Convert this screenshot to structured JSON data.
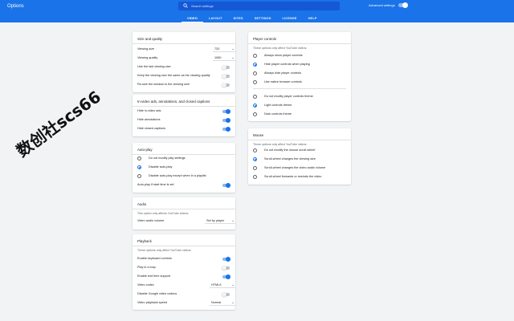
{
  "header": {
    "title": "Options",
    "search_placeholder": "Search settings",
    "advanced_label": "Advanced settings",
    "advanced_on": true,
    "tabs": [
      {
        "label": "VIDEO",
        "active": true
      },
      {
        "label": "LAYOUT",
        "active": false
      },
      {
        "label": "SITES",
        "active": false
      },
      {
        "label": "SETTINGS",
        "active": false
      },
      {
        "label": "LICENSE",
        "active": false
      },
      {
        "label": "HELP",
        "active": false
      }
    ]
  },
  "size_quality": {
    "title": "Size and quality",
    "viewing_size_label": "Viewing size",
    "viewing_size_value": "720",
    "viewing_quality_label": "Viewing quality",
    "viewing_quality_value": "1080",
    "use_last_size_label": "Use the last viewing size",
    "use_last_size_on": false,
    "keep_size_label": "Keep the viewing size the same as the viewing quality",
    "keep_size_on": false,
    "resize_window_label": "Re-size the window to the viewing size",
    "resize_window_on": false
  },
  "in_video": {
    "title": "In-video ads, annotations, and closed captions",
    "hide_ads_label": "Hide in-video ads",
    "hide_ads_on": true,
    "hide_annotations_label": "Hide annotations",
    "hide_annotations_on": true,
    "hide_captions_label": "Hide closed captions",
    "hide_captions_on": true
  },
  "autoplay": {
    "title": "Auto-play",
    "option_1": "Do not modify play settings",
    "option_2": "Disable auto-play",
    "option_3": "Disable auto-play except when in a playlist",
    "selected": 2,
    "start_time_label": "Auto-play if start time is set",
    "start_time_on": true
  },
  "audio": {
    "title": "Audio",
    "note": "This option only affects YouTube videos:",
    "volume_label": "Video audio volume",
    "volume_value": "Set by player"
  },
  "playback": {
    "title": "Playback",
    "note": "These options only affect YouTube videos:",
    "keyboard_label": "Enable keyboard controls",
    "keyboard_on": true,
    "loop_label": "Play in a loop",
    "loop_on": false,
    "time_support_label": "Enable end time support",
    "time_support_on": true,
    "codec_label": "Video codec",
    "codec_value": "HTML5",
    "google_video_label": "Disable Google video codecs",
    "google_video_on": false,
    "speed_label": "Video playback speed",
    "speed_value": "Normal"
  },
  "player_controls": {
    "title": "Player controls",
    "note": "These options only affect YouTube videos:",
    "option_1": "Always show player controls",
    "option_2": "Hide player controls when playing",
    "option_3": "Always hide player controls",
    "option_4": "Use native browser controls",
    "selected": 2,
    "theme_1": "Do not modify player controls theme",
    "theme_2": "Light controls theme",
    "theme_3": "Dark controls theme",
    "theme_selected": 2
  },
  "mouse": {
    "title": "Mouse",
    "note": "These options only affect YouTube videos:",
    "option_1": "Do not modify the mouse scroll-wheel",
    "option_2": "Scroll-wheel changes the viewing size",
    "option_3": "Scroll-wheel changes the video audio volume",
    "option_4": "Scroll-wheel forwards or rewinds the video",
    "selected": 2
  },
  "watermark": {
    "text": "数创社scs66",
    "color": "#111111"
  },
  "colors": {
    "accent": "#1a73e8",
    "page_bg": "#f1f3f4"
  }
}
